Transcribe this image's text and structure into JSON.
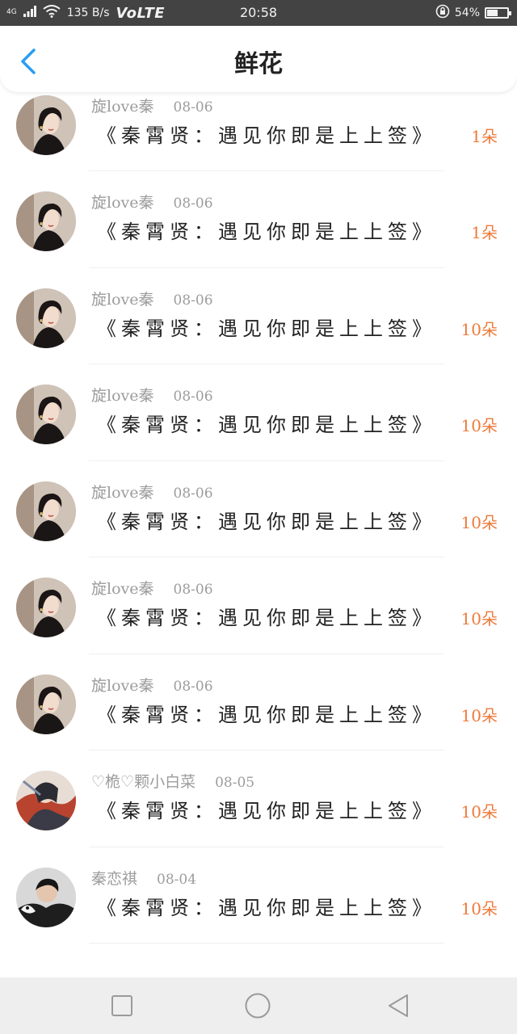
{
  "status_bar": {
    "network": "4G",
    "data_rate": "135 B/s",
    "volte": "VoLTE",
    "time": "20:58",
    "battery_percent_label": "54%",
    "battery_level": 0.54
  },
  "header": {
    "title": "鲜花"
  },
  "list": {
    "items": [
      {
        "user": "",
        "date": "",
        "gift": "《秦霄贤：遇见你即是上上签》",
        "count": "1朵",
        "avatar": "girl-portrait"
      },
      {
        "user": "旋love秦",
        "date": "08-06",
        "gift": "《秦霄贤：遇见你即是上上签》",
        "count": "1朵",
        "avatar": "girl-portrait"
      },
      {
        "user": "旋love秦",
        "date": "08-06",
        "gift": "《秦霄贤：遇见你即是上上签》",
        "count": "1朵",
        "avatar": "girl-portrait"
      },
      {
        "user": "旋love秦",
        "date": "08-06",
        "gift": "《秦霄贤：遇见你即是上上签》",
        "count": "10朵",
        "avatar": "girl-portrait"
      },
      {
        "user": "旋love秦",
        "date": "08-06",
        "gift": "《秦霄贤：遇见你即是上上签》",
        "count": "10朵",
        "avatar": "girl-portrait"
      },
      {
        "user": "旋love秦",
        "date": "08-06",
        "gift": "《秦霄贤：遇见你即是上上签》",
        "count": "10朵",
        "avatar": "girl-portrait"
      },
      {
        "user": "旋love秦",
        "date": "08-06",
        "gift": "《秦霄贤：遇见你即是上上签》",
        "count": "10朵",
        "avatar": "girl-portrait"
      },
      {
        "user": "旋love秦",
        "date": "08-06",
        "gift": "《秦霄贤：遇见你即是上上签》",
        "count": "10朵",
        "avatar": "girl-portrait"
      },
      {
        "user": "♡桅♡颗小白菜",
        "date": "08-05",
        "gift": "《秦霄贤：遇见你即是上上签》",
        "count": "10朵",
        "avatar": "painted-art"
      },
      {
        "user": "秦恋祺",
        "date": "08-04",
        "gift": "《秦霄贤：遇见你即是上上签》",
        "count": "10朵",
        "avatar": "boy-photo"
      }
    ]
  },
  "nav_bar": {
    "buttons": [
      "recents",
      "home",
      "back"
    ]
  },
  "colors": {
    "accent_blue": "#2a9df4",
    "count_orange": "#ee7a3a",
    "status_bar_bg": "#434343"
  }
}
